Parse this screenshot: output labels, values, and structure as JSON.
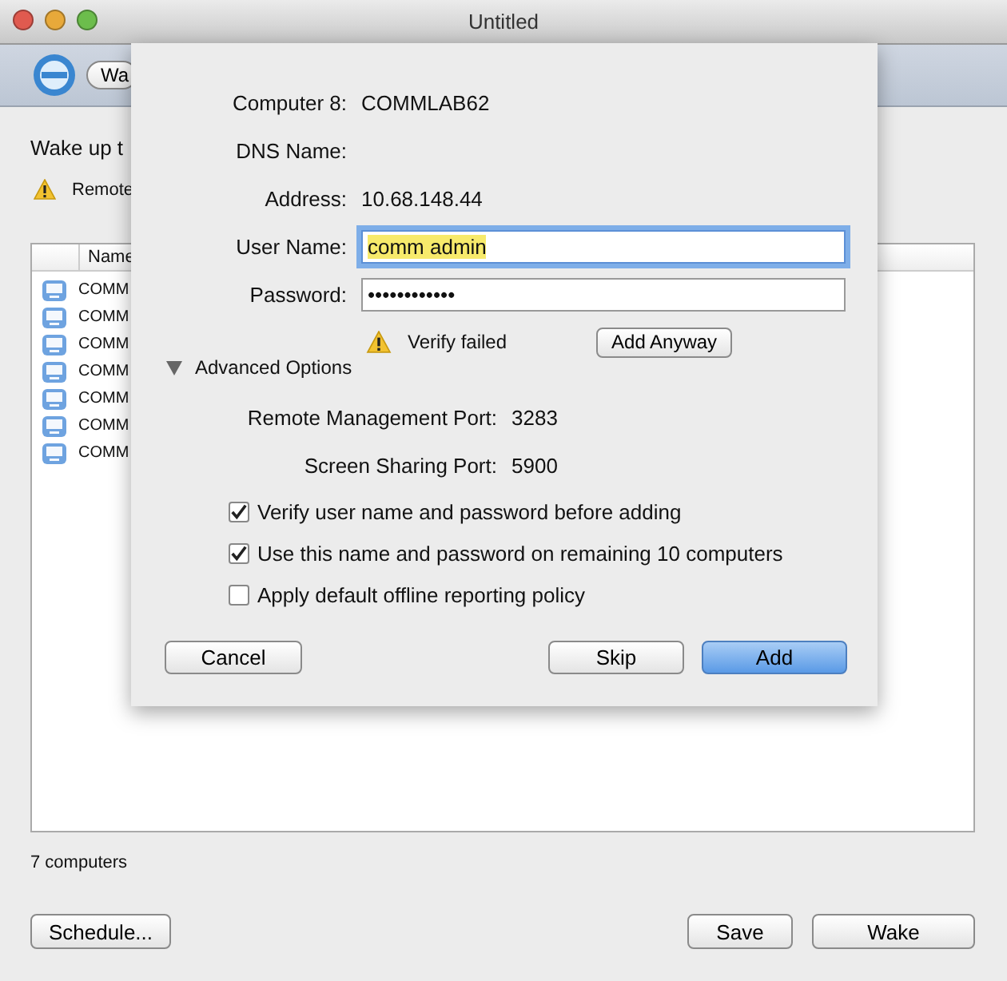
{
  "window": {
    "title": "Untitled"
  },
  "toolbar": {
    "task_button": "Wa"
  },
  "instruction": "Wake up t",
  "warning": "Remote",
  "table": {
    "columns": [
      "Name"
    ],
    "rows": [
      {
        "name": "COMM"
      },
      {
        "name": "COMM"
      },
      {
        "name": "COMM"
      },
      {
        "name": "COMM"
      },
      {
        "name": "COMM"
      },
      {
        "name": "COMM"
      },
      {
        "name": "COMM"
      }
    ]
  },
  "count": "7 computers",
  "buttons": [
    {
      "label": "Schedule...",
      "default": false
    },
    {
      "label": "Save",
      "default": false
    },
    {
      "label": "Wake",
      "default": false
    }
  ],
  "sheet": {
    "info": [
      {
        "label": "Computer 8:",
        "value": "COMMLAB62"
      },
      {
        "label": "DNS Name:"
      },
      {
        "label": "Address:",
        "value": "10.68.148.44"
      }
    ],
    "inputs": [
      {
        "label": "User Name:",
        "value": "comm admin",
        "focused": true
      },
      {
        "label": "Password:",
        "value": "••••••••••••",
        "focused": false
      }
    ],
    "verify": {
      "message": "Verify failed",
      "button": "Add Anyway"
    },
    "advanced": {
      "label": "Advanced Options",
      "expanded": true
    },
    "ports": [
      {
        "label": "Remote Management Port:",
        "value": "3283"
      },
      {
        "label": "Screen Sharing Port:",
        "value": "5900"
      }
    ],
    "options": [
      {
        "label": "Verify user name and password before adding",
        "checked": true
      },
      {
        "label": "Use this name and password on remaining 10 computers",
        "checked": true
      },
      {
        "label": "Apply default offline reporting policy",
        "checked": false
      }
    ],
    "buttons": [
      {
        "label": "Cancel",
        "default": false
      },
      {
        "label": "Skip",
        "default": false
      },
      {
        "label": "Add",
        "default": true
      }
    ]
  }
}
